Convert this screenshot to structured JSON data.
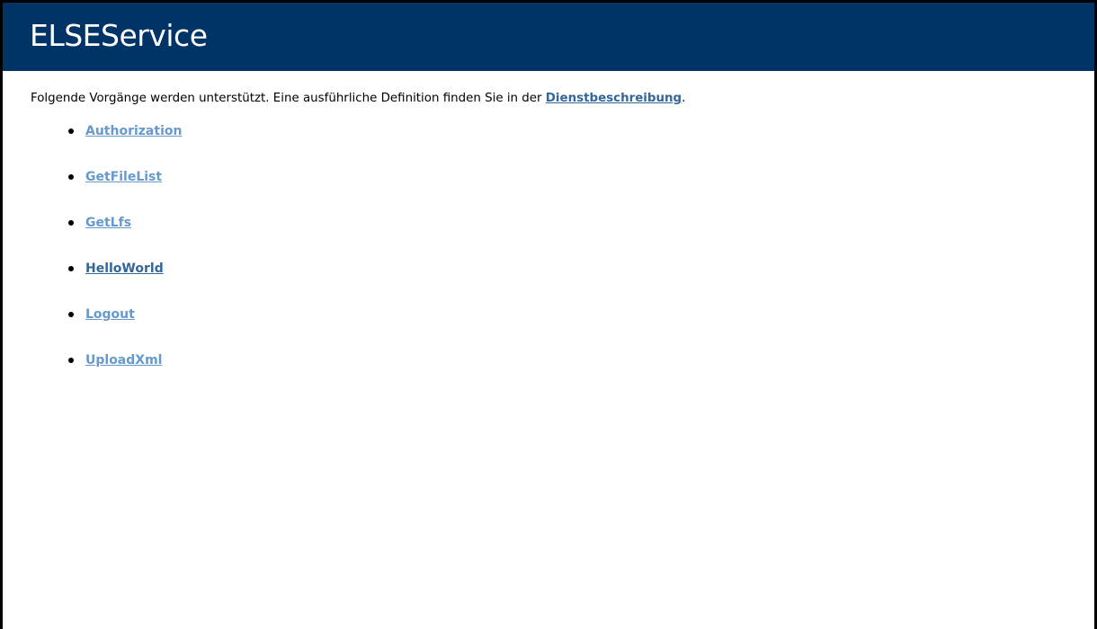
{
  "header": {
    "title": "ELSEService"
  },
  "intro": {
    "text_before": "Folgende Vorgänge werden unterstützt. Eine ausführliche Definition finden Sie in der ",
    "link_label": "Dienstbeschreibung",
    "text_after": "."
  },
  "operations": [
    {
      "label": "Authorization",
      "state": "unvisited"
    },
    {
      "label": "GetFileList",
      "state": "unvisited"
    },
    {
      "label": "GetLfs",
      "state": "unvisited"
    },
    {
      "label": "HelloWorld",
      "state": "visited"
    },
    {
      "label": "Logout",
      "state": "unvisited"
    },
    {
      "label": "UploadXml",
      "state": "unvisited"
    }
  ],
  "colors": {
    "banner_background": "#003366",
    "banner_text": "#ffffff",
    "link_unvisited": "#6699cc",
    "link_visited": "#336699"
  }
}
